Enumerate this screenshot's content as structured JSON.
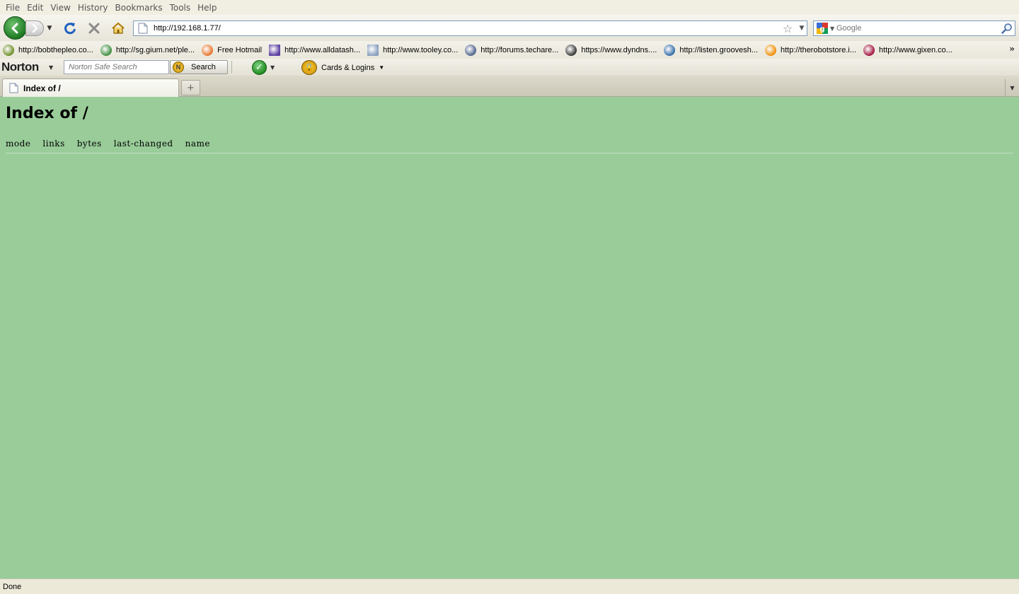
{
  "menubar": {
    "items": [
      "File",
      "Edit",
      "View",
      "History",
      "Bookmarks",
      "Tools",
      "Help"
    ]
  },
  "navbar": {
    "url": "http://192.168.1.77/",
    "search_placeholder": "Google"
  },
  "bookmarks": {
    "items": [
      {
        "label": "http://bobthepleo.co...",
        "icon": "dinosaur-icon",
        "color": "#6b8e23"
      },
      {
        "label": "http://sg.gium.net/ple...",
        "icon": "leaf-icon",
        "color": "#3c8c3c"
      },
      {
        "label": "Free Hotmail",
        "icon": "windows-icon",
        "color": "#e8732a"
      },
      {
        "label": "http://www.alldatash...",
        "icon": "pdf-icon",
        "color": "#5a3fa0"
      },
      {
        "label": "http://www.tooley.co...",
        "icon": "page-icon",
        "color": "#8aa0c0"
      },
      {
        "label": "http://forums.techare...",
        "icon": "globe-icon",
        "color": "#4a5f8a"
      },
      {
        "label": "https://www.dyndns....",
        "icon": "ring-icon",
        "color": "#333333"
      },
      {
        "label": "http://listen.groovesh...",
        "icon": "grooveshark-icon",
        "color": "#2f6aa8"
      },
      {
        "label": "http://therobotstore.i...",
        "icon": "robot-icon",
        "color": "#f08a00"
      },
      {
        "label": "http://www.gixen.co...",
        "icon": "gixen-icon",
        "color": "#a0103a"
      }
    ],
    "more_label": "»"
  },
  "norton": {
    "logo": "Norton",
    "search_placeholder": "Norton Safe Search",
    "search_button": "Search",
    "cards_label": "Cards & Logins"
  },
  "tabs": [
    {
      "title": "Index of /",
      "active": true
    }
  ],
  "newtab_label": "+",
  "page": {
    "title": "Index of /",
    "columns": [
      "mode",
      "links",
      "bytes",
      "last-changed",
      "name"
    ]
  },
  "status": {
    "text": "Done"
  },
  "colors": {
    "content_bg": "#99cc99",
    "back_button": "#1d7a23"
  }
}
